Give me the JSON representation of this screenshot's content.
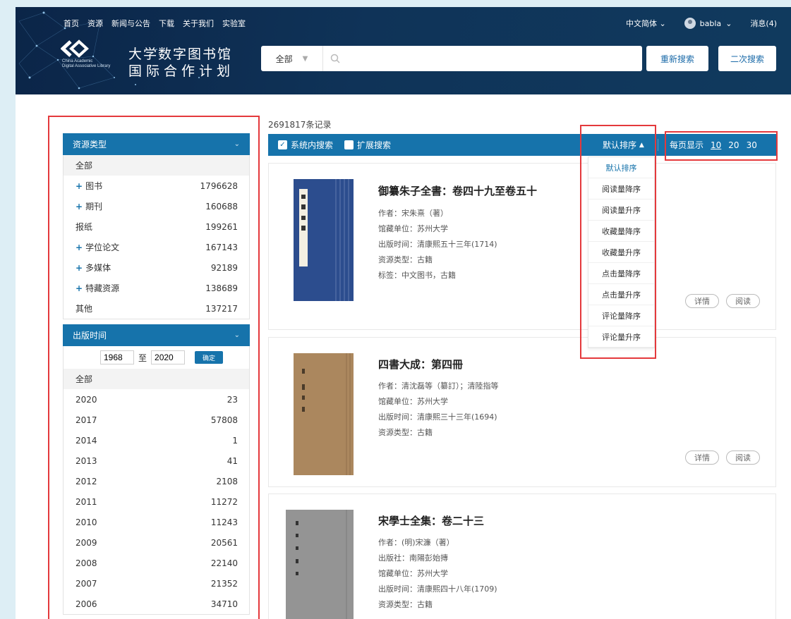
{
  "nav": {
    "items": [
      "首页",
      "资源",
      "新闻与公告",
      "下载",
      "关于我们",
      "实验室"
    ],
    "language": "中文简体",
    "username": "babla",
    "messages": "消息(4)"
  },
  "brand": {
    "logo_sub1": "China Academic",
    "logo_sub2": "Digital Associative Library",
    "title_line1": "大学数字图书馆",
    "title_line2": "国际合作计划"
  },
  "search": {
    "scope": "全部",
    "query": "",
    "research_button": "重新搜索",
    "secondary_button": "二次搜索"
  },
  "sidebar": {
    "resource_type": {
      "title": "资源类型",
      "all": "全部",
      "items": [
        {
          "label": "图书",
          "count": "1796628",
          "expandable": true
        },
        {
          "label": "期刊",
          "count": "160688",
          "expandable": true
        },
        {
          "label": "报纸",
          "count": "199261",
          "expandable": false
        },
        {
          "label": "学位论文",
          "count": "167143",
          "expandable": true
        },
        {
          "label": "多媒体",
          "count": "92189",
          "expandable": true
        },
        {
          "label": "特藏资源",
          "count": "138689",
          "expandable": true
        },
        {
          "label": "其他",
          "count": "137217",
          "expandable": false
        }
      ]
    },
    "pub_time": {
      "title": "出版时间",
      "from": "1968",
      "to_label": "至",
      "to": "2020",
      "confirm": "确定",
      "all": "全部",
      "items": [
        {
          "year": "2020",
          "count": "23"
        },
        {
          "year": "2017",
          "count": "57808"
        },
        {
          "year": "2014",
          "count": "1"
        },
        {
          "year": "2013",
          "count": "41"
        },
        {
          "year": "2012",
          "count": "2108"
        },
        {
          "year": "2011",
          "count": "11272"
        },
        {
          "year": "2010",
          "count": "11243"
        },
        {
          "year": "2009",
          "count": "20561"
        },
        {
          "year": "2008",
          "count": "22140"
        },
        {
          "year": "2007",
          "count": "21352"
        },
        {
          "year": "2006",
          "count": "34710"
        }
      ]
    }
  },
  "results": {
    "count_text": "2691817条记录",
    "in_system": "系统内搜索",
    "expand": "扩展搜索",
    "sort_label": "默认排序",
    "per_page_label": "每页显示",
    "per_page_options": [
      "10",
      "20",
      "30"
    ],
    "sort_options": [
      "默认排序",
      "阅读量降序",
      "阅读量升序",
      "收藏量降序",
      "收藏量升序",
      "点击量降序",
      "点击量升序",
      "评论量降序",
      "评论量升序"
    ],
    "detail_label": "详情",
    "read_label": "阅读",
    "books": [
      {
        "title": "御纂朱子全書：卷四十九至卷五十",
        "meta": [
          "作者：宋朱熹（著）",
          "馆藏单位：苏州大学",
          "出版时间：清康熙五十三年(1714)",
          "资源类型：古籍",
          "标签：中文图书，古籍"
        ]
      },
      {
        "title": "四書大成：第四冊",
        "meta": [
          "作者：清沈磊等（纂訂）；清陸指等",
          "馆藏单位：苏州大学",
          "出版时间：清康熙三十三年(1694)",
          "资源类型：古籍"
        ]
      },
      {
        "title": "宋學士全集：卷二十三",
        "meta": [
          "作者：(明)宋濂（著）",
          "出版社：南陽彭始摶",
          "馆藏单位：苏州大学",
          "出版时间：清康熙四十八年(1709)",
          "资源类型：古籍"
        ]
      }
    ]
  },
  "colors": {
    "primary": "#1673ab",
    "header_dark": "#0b2548",
    "highlight_box": "#e4393c"
  }
}
